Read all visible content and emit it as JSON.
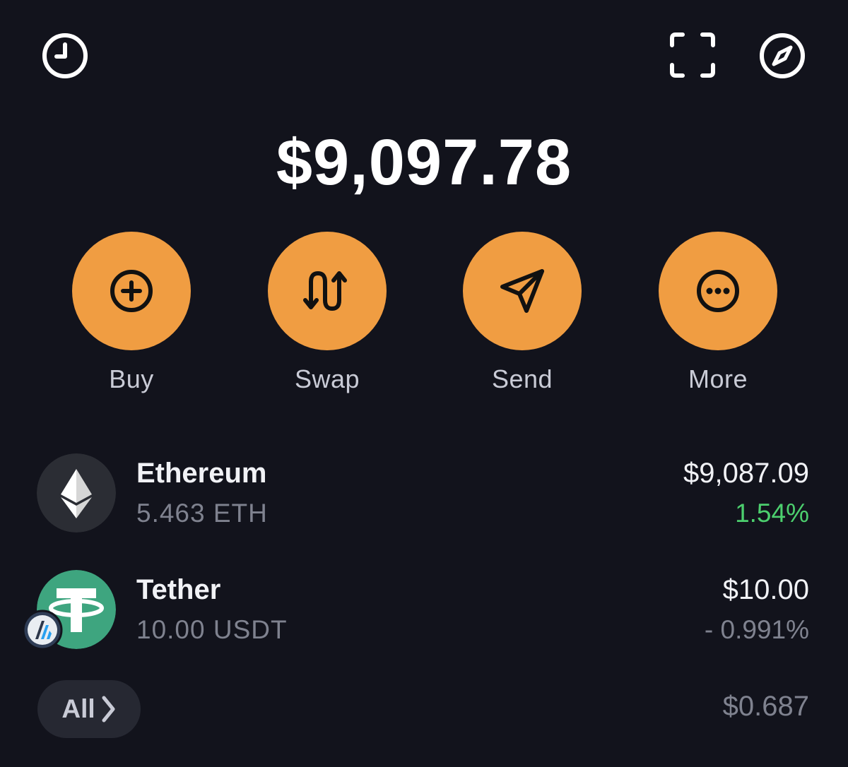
{
  "header": {
    "left_icon": "history-clock-icon",
    "right_icons": [
      "scan-frame-icon",
      "compass-icon"
    ]
  },
  "balance": {
    "total": "$9,097.78"
  },
  "actions": [
    {
      "label": "Buy",
      "icon": "plus-circle-icon"
    },
    {
      "label": "Swap",
      "icon": "swap-arrows-icon"
    },
    {
      "label": "Send",
      "icon": "send-paper-plane-icon"
    },
    {
      "label": "More",
      "icon": "more-dots-icon"
    }
  ],
  "assets": [
    {
      "name": "Ethereum",
      "amount": "5.463 ETH",
      "value": "$9,087.09",
      "change": "1.54%",
      "change_color": "#4ccf6e",
      "icon": "ethereum-logo-icon"
    },
    {
      "name": "Tether",
      "amount": "10.00 USDT",
      "value": "$10.00",
      "change": "- 0.991%",
      "change_color": "#7f828f",
      "icon": "tether-logo-icon",
      "network_badge_icon": "arbitrum-badge-icon"
    }
  ],
  "footer": {
    "all_label": "All",
    "other_value": "$0.687"
  },
  "colors": {
    "background": "#12131c",
    "accent": "#f09d42",
    "positive": "#4ccf6e",
    "muted": "#7f828f"
  }
}
